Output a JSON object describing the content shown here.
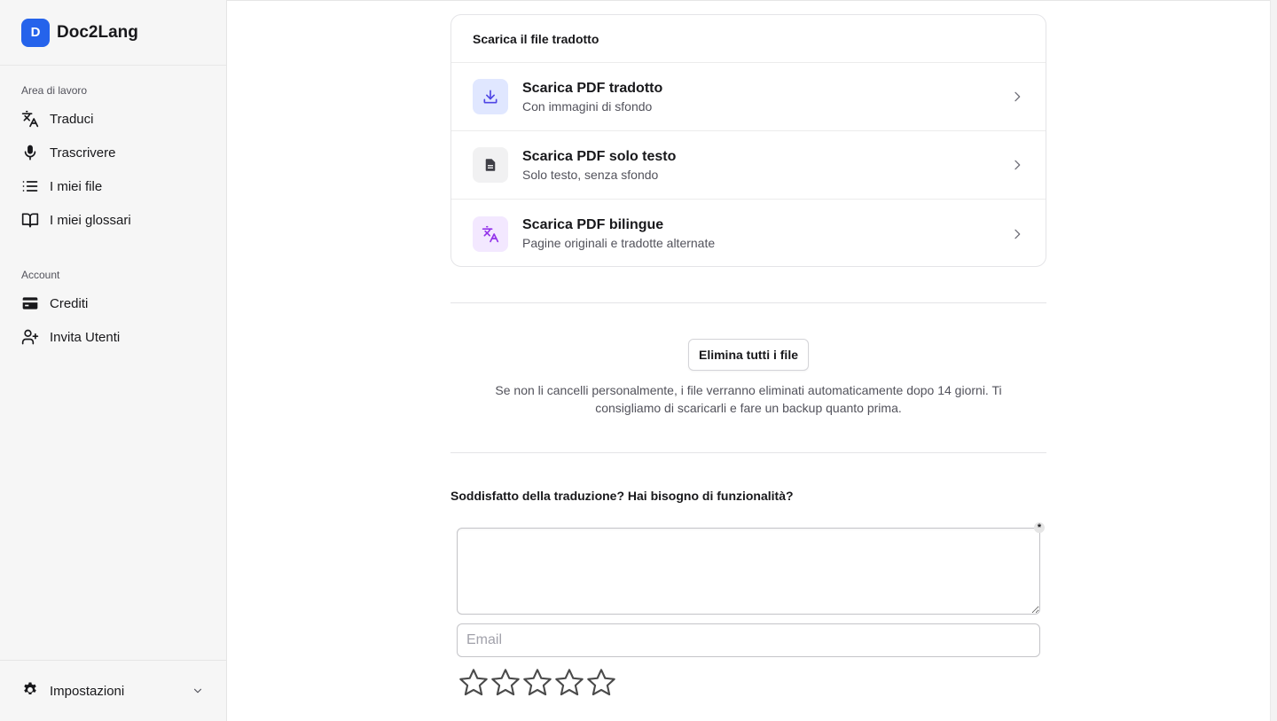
{
  "app": {
    "name": "Doc2Lang",
    "logo_letter": "D",
    "accent": "#2563eb"
  },
  "sidebar": {
    "workspace_title": "Area di lavoro",
    "workspace_items": [
      {
        "label": "Traduci",
        "icon": "translate-icon"
      },
      {
        "label": "Trascrivere",
        "icon": "microphone-icon"
      },
      {
        "label": "I miei file",
        "icon": "list-icon"
      },
      {
        "label": "I miei glossari",
        "icon": "book-icon"
      }
    ],
    "account_title": "Account",
    "account_items": [
      {
        "label": "Crediti",
        "icon": "credit-card-icon"
      },
      {
        "label": "Invita Utenti",
        "icon": "user-plus-icon"
      }
    ],
    "footer": {
      "label": "Impostazioni",
      "icon": "gear-icon"
    }
  },
  "download": {
    "title": "Scarica il file tradotto",
    "options": [
      {
        "title": "Scarica PDF tradotto",
        "subtitle": "Con immagini di sfondo",
        "icon": "download-icon",
        "icon_bg": "#e0e7ff",
        "icon_color": "#4f46e5"
      },
      {
        "title": "Scarica PDF solo testo",
        "subtitle": "Solo testo, senza sfondo",
        "icon": "document-icon",
        "icon_bg": "#f1f1f2",
        "icon_color": "#3f3f46"
      },
      {
        "title": "Scarica PDF bilingue",
        "subtitle": "Pagine originali e tradotte alternate",
        "icon": "translate-icon",
        "icon_bg": "#f3e8ff",
        "icon_color": "#9333ea"
      }
    ]
  },
  "files": {
    "delete_label": "Elimina tutti i file",
    "notice": "Se non li cancelli personalmente, i file verranno eliminati automaticamente dopo 14 giorni. Ti consigliamo di scaricarli e fare un backup quanto prima."
  },
  "feedback": {
    "title": "Soddisfatto della traduzione? Hai bisogno di funzionalità?",
    "message_value": "",
    "required_mark": "*",
    "email_placeholder": "Email",
    "rating": {
      "value": 0,
      "max": 5
    }
  }
}
